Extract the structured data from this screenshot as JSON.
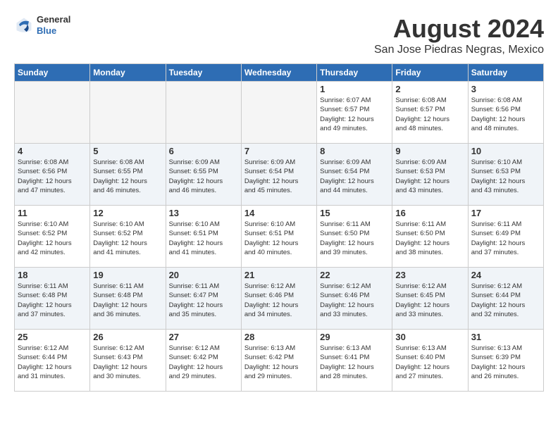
{
  "logo": {
    "general": "General",
    "blue": "Blue"
  },
  "title": "August 2024",
  "location": "San Jose Piedras Negras, Mexico",
  "days": [
    "Sunday",
    "Monday",
    "Tuesday",
    "Wednesday",
    "Thursday",
    "Friday",
    "Saturday"
  ],
  "weeks": [
    [
      {
        "day": "",
        "info": ""
      },
      {
        "day": "",
        "info": ""
      },
      {
        "day": "",
        "info": ""
      },
      {
        "day": "",
        "info": ""
      },
      {
        "day": "1",
        "info": "Sunrise: 6:07 AM\nSunset: 6:57 PM\nDaylight: 12 hours\nand 49 minutes."
      },
      {
        "day": "2",
        "info": "Sunrise: 6:08 AM\nSunset: 6:57 PM\nDaylight: 12 hours\nand 48 minutes."
      },
      {
        "day": "3",
        "info": "Sunrise: 6:08 AM\nSunset: 6:56 PM\nDaylight: 12 hours\nand 48 minutes."
      }
    ],
    [
      {
        "day": "4",
        "info": "Sunrise: 6:08 AM\nSunset: 6:56 PM\nDaylight: 12 hours\nand 47 minutes."
      },
      {
        "day": "5",
        "info": "Sunrise: 6:08 AM\nSunset: 6:55 PM\nDaylight: 12 hours\nand 46 minutes."
      },
      {
        "day": "6",
        "info": "Sunrise: 6:09 AM\nSunset: 6:55 PM\nDaylight: 12 hours\nand 46 minutes."
      },
      {
        "day": "7",
        "info": "Sunrise: 6:09 AM\nSunset: 6:54 PM\nDaylight: 12 hours\nand 45 minutes."
      },
      {
        "day": "8",
        "info": "Sunrise: 6:09 AM\nSunset: 6:54 PM\nDaylight: 12 hours\nand 44 minutes."
      },
      {
        "day": "9",
        "info": "Sunrise: 6:09 AM\nSunset: 6:53 PM\nDaylight: 12 hours\nand 43 minutes."
      },
      {
        "day": "10",
        "info": "Sunrise: 6:10 AM\nSunset: 6:53 PM\nDaylight: 12 hours\nand 43 minutes."
      }
    ],
    [
      {
        "day": "11",
        "info": "Sunrise: 6:10 AM\nSunset: 6:52 PM\nDaylight: 12 hours\nand 42 minutes."
      },
      {
        "day": "12",
        "info": "Sunrise: 6:10 AM\nSunset: 6:52 PM\nDaylight: 12 hours\nand 41 minutes."
      },
      {
        "day": "13",
        "info": "Sunrise: 6:10 AM\nSunset: 6:51 PM\nDaylight: 12 hours\nand 41 minutes."
      },
      {
        "day": "14",
        "info": "Sunrise: 6:10 AM\nSunset: 6:51 PM\nDaylight: 12 hours\nand 40 minutes."
      },
      {
        "day": "15",
        "info": "Sunrise: 6:11 AM\nSunset: 6:50 PM\nDaylight: 12 hours\nand 39 minutes."
      },
      {
        "day": "16",
        "info": "Sunrise: 6:11 AM\nSunset: 6:50 PM\nDaylight: 12 hours\nand 38 minutes."
      },
      {
        "day": "17",
        "info": "Sunrise: 6:11 AM\nSunset: 6:49 PM\nDaylight: 12 hours\nand 37 minutes."
      }
    ],
    [
      {
        "day": "18",
        "info": "Sunrise: 6:11 AM\nSunset: 6:48 PM\nDaylight: 12 hours\nand 37 minutes."
      },
      {
        "day": "19",
        "info": "Sunrise: 6:11 AM\nSunset: 6:48 PM\nDaylight: 12 hours\nand 36 minutes."
      },
      {
        "day": "20",
        "info": "Sunrise: 6:11 AM\nSunset: 6:47 PM\nDaylight: 12 hours\nand 35 minutes."
      },
      {
        "day": "21",
        "info": "Sunrise: 6:12 AM\nSunset: 6:46 PM\nDaylight: 12 hours\nand 34 minutes."
      },
      {
        "day": "22",
        "info": "Sunrise: 6:12 AM\nSunset: 6:46 PM\nDaylight: 12 hours\nand 33 minutes."
      },
      {
        "day": "23",
        "info": "Sunrise: 6:12 AM\nSunset: 6:45 PM\nDaylight: 12 hours\nand 33 minutes."
      },
      {
        "day": "24",
        "info": "Sunrise: 6:12 AM\nSunset: 6:44 PM\nDaylight: 12 hours\nand 32 minutes."
      }
    ],
    [
      {
        "day": "25",
        "info": "Sunrise: 6:12 AM\nSunset: 6:44 PM\nDaylight: 12 hours\nand 31 minutes."
      },
      {
        "day": "26",
        "info": "Sunrise: 6:12 AM\nSunset: 6:43 PM\nDaylight: 12 hours\nand 30 minutes."
      },
      {
        "day": "27",
        "info": "Sunrise: 6:12 AM\nSunset: 6:42 PM\nDaylight: 12 hours\nand 29 minutes."
      },
      {
        "day": "28",
        "info": "Sunrise: 6:13 AM\nSunset: 6:42 PM\nDaylight: 12 hours\nand 29 minutes."
      },
      {
        "day": "29",
        "info": "Sunrise: 6:13 AM\nSunset: 6:41 PM\nDaylight: 12 hours\nand 28 minutes."
      },
      {
        "day": "30",
        "info": "Sunrise: 6:13 AM\nSunset: 6:40 PM\nDaylight: 12 hours\nand 27 minutes."
      },
      {
        "day": "31",
        "info": "Sunrise: 6:13 AM\nSunset: 6:39 PM\nDaylight: 12 hours\nand 26 minutes."
      }
    ]
  ]
}
